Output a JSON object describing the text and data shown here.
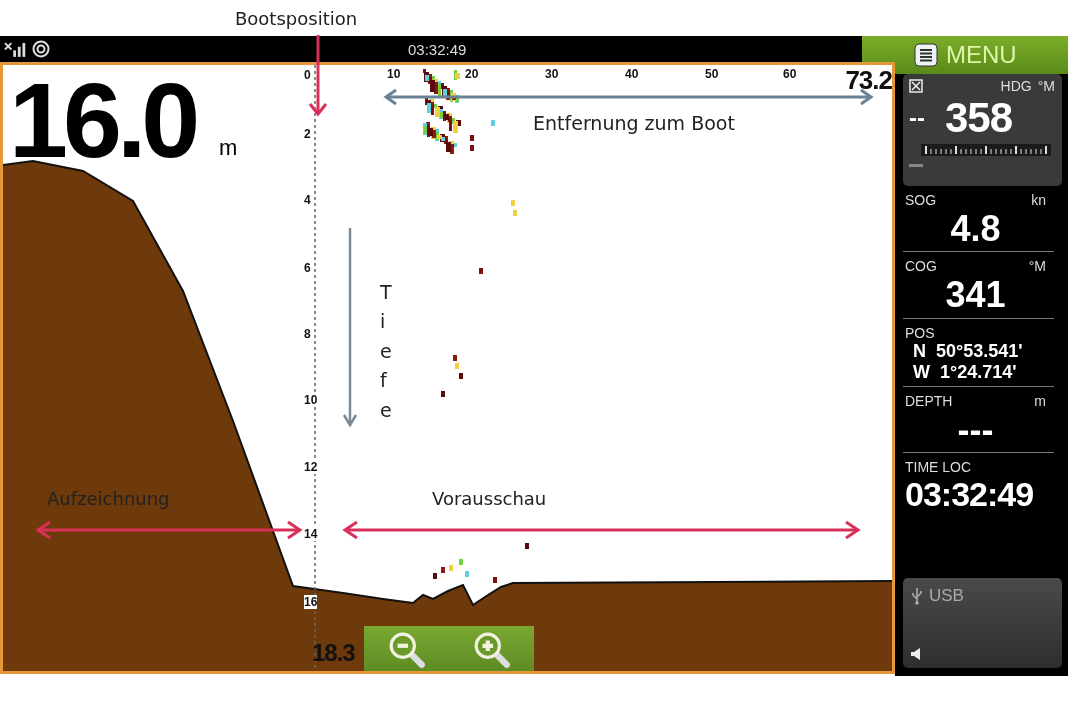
{
  "annotations": {
    "boat_position": "Bootsposition",
    "distance": "Entfernung zum Boot",
    "depth": "Tiefe",
    "history": "Aufzeichnung",
    "forward": "Vorausschau"
  },
  "status_bar": {
    "time": "03:32:49"
  },
  "menu_button": "MENU",
  "sonar": {
    "depth_reading": "16.0",
    "depth_unit": "m",
    "depth_scale": [
      "0",
      "2",
      "4",
      "6",
      "8",
      "10",
      "12",
      "14",
      "16"
    ],
    "max_depth": "18.3",
    "distance_scale": [
      "10",
      "20",
      "30",
      "40",
      "50",
      "60"
    ],
    "max_distance": "73.2"
  },
  "instruments": [
    {
      "kind": "heading",
      "label": "HDG",
      "unit": "°M",
      "prefix": "--",
      "value": "358"
    },
    {
      "kind": "value",
      "label": "SOG",
      "unit": "kn",
      "value": "4.8"
    },
    {
      "kind": "value",
      "label": "COG",
      "unit": "°M",
      "value": "341"
    },
    {
      "kind": "position",
      "label": "POS",
      "lines": [
        {
          "hemisphere": "N",
          "coord": "50°53.541'"
        },
        {
          "hemisphere": "W",
          "coord": "1°24.714'"
        }
      ]
    },
    {
      "kind": "value",
      "label": "DEPTH",
      "unit": "m",
      "value": "---"
    },
    {
      "kind": "time",
      "label": "TIME LOC",
      "value": "03:32:49"
    }
  ],
  "usb": {
    "label": "USB"
  }
}
